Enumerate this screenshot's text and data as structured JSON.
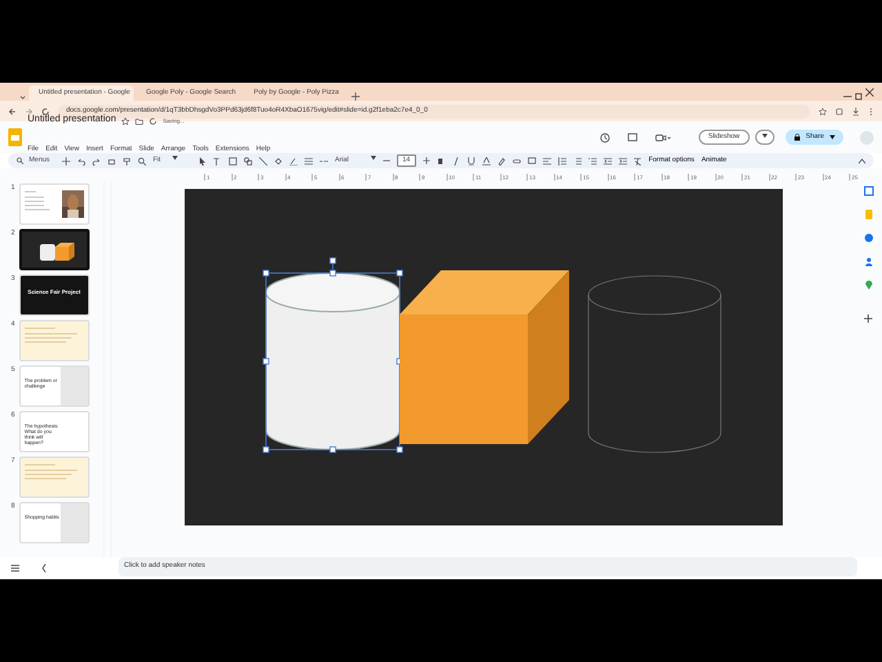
{
  "browser": {
    "tabs": [
      {
        "title": "Untitled presentation - Google",
        "selected": true
      },
      {
        "title": "Google Poly - Google Search",
        "selected": false
      },
      {
        "title": "Poly by Google - Poly Pizza",
        "selected": false
      }
    ],
    "url": "docs.google.com/presentation/d/1qT3bbDhsgdVo3PPd63jd6f8Tuo4oR4XbaO1675vig/edit#slide=id.g2f1eba2c7e4_0_0"
  },
  "document": {
    "title": "Untitled presentation",
    "status": "Saving..."
  },
  "menu": [
    "File",
    "Edit",
    "View",
    "Insert",
    "Format",
    "Slide",
    "Arrange",
    "Tools",
    "Extensions",
    "Help"
  ],
  "header_buttons": {
    "slideshow": "Slideshow",
    "share": "Share"
  },
  "toolbar": {
    "search_placeholder": "Menus",
    "zoom": "Fit",
    "font": "Arial",
    "font_size": "14",
    "format_options": "Format options",
    "animate": "Animate"
  },
  "ruler": [
    "1",
    "2",
    "3",
    "4",
    "5",
    "6",
    "7",
    "8",
    "9",
    "10",
    "11",
    "12",
    "13",
    "14",
    "15",
    "16",
    "17",
    "18",
    "19",
    "20",
    "21",
    "22",
    "23",
    "24",
    "25"
  ],
  "slides": [
    {
      "number": "1",
      "selected": false
    },
    {
      "number": "2",
      "kind": "cubes",
      "selected": true
    },
    {
      "number": "3",
      "kind": "dark",
      "title": "Science Fair Project",
      "selected": false
    },
    {
      "number": "4",
      "kind": "yellow",
      "selected": false
    },
    {
      "number": "5",
      "kind": "white-image",
      "title": "The problem or challenge",
      "selected": false
    },
    {
      "number": "6",
      "kind": "white",
      "title": "The hypothesis: What do you think will happen?",
      "selected": false
    },
    {
      "number": "7",
      "kind": "yellow",
      "selected": false
    },
    {
      "number": "8",
      "kind": "white-image",
      "title": "Shopping habits",
      "selected": false
    }
  ],
  "canvas": {
    "shapes": [
      {
        "kind": "cylinder",
        "selected": true
      },
      {
        "kind": "cube",
        "selected": false
      },
      {
        "kind": "wire-cylinder",
        "selected": false
      }
    ]
  },
  "speaker_notes": {
    "placeholder": "Click to add speaker notes"
  }
}
